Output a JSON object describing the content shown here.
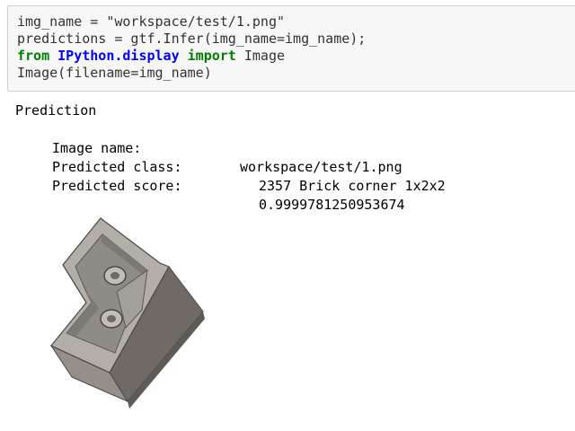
{
  "code_cell": {
    "line1": {
      "text": "img_name = \"workspace/test/1.png\""
    },
    "line2": {
      "text": "predictions = gtf.Infer(img_name=img_name);"
    },
    "line3": {
      "kw_from": "from",
      "module": "IPython.display",
      "kw_import": "import",
      "rest": "Image"
    },
    "line4": {
      "text": "Image(filename=img_name)"
    }
  },
  "output": {
    "heading": "Prediction",
    "rows": [
      {
        "key": "Image name:",
        "value": "workspace/test/1.png"
      },
      {
        "key": "Predicted class:",
        "value": "2357 Brick corner 1x2x2"
      },
      {
        "key": "Predicted score:",
        "value": "0.9999781250953674"
      }
    ]
  },
  "image_output": {
    "subject": "lego-brick-corner-icon",
    "colors": {
      "top": "#b3aea8",
      "inner_floor": "#8f8b86",
      "side_dark": "#6f6a66",
      "side_mid": "#948f8a",
      "stud": "#c2bdb7",
      "outline": "#4a4642"
    }
  }
}
